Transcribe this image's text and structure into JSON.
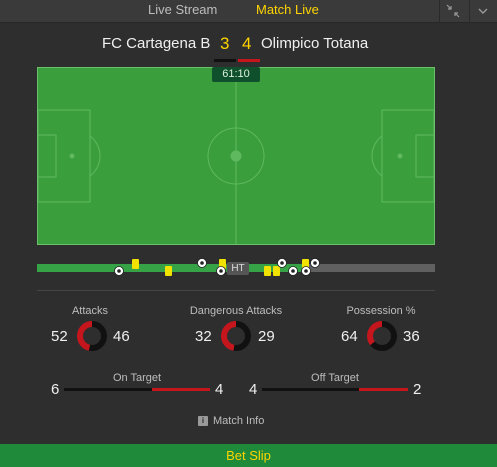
{
  "tabs": {
    "live_stream": "Live Stream",
    "match_live": "Match Live"
  },
  "match": {
    "home_team": "FC Cartagena B",
    "away_team": "Olimpico Totana",
    "home_score": "3",
    "away_score": "4",
    "clock": "61:10",
    "home_color": "#111111",
    "away_color": "#c4161c"
  },
  "timeline": {
    "progress_fraction": 0.68,
    "halftime_label": "HT"
  },
  "stats": {
    "attacks": {
      "label": "Attacks",
      "home": "52",
      "away": "46"
    },
    "dangerous_attacks": {
      "label": "Dangerous Attacks",
      "home": "32",
      "away": "29"
    },
    "possession": {
      "label": "Possession %",
      "home": "64",
      "away": "36"
    },
    "on_target": {
      "label": "On Target",
      "home": "6",
      "away": "4"
    },
    "off_target": {
      "label": "Off Target",
      "home": "4",
      "away": "2"
    }
  },
  "footer": {
    "match_info": "Match Info",
    "bet_slip": "Bet Slip"
  },
  "icons": {
    "collapse": "collapse-icon",
    "chevron": "chevron-down-icon",
    "info": "info-icon",
    "yellow_card": "yellow-card-icon",
    "goal": "football-icon"
  }
}
